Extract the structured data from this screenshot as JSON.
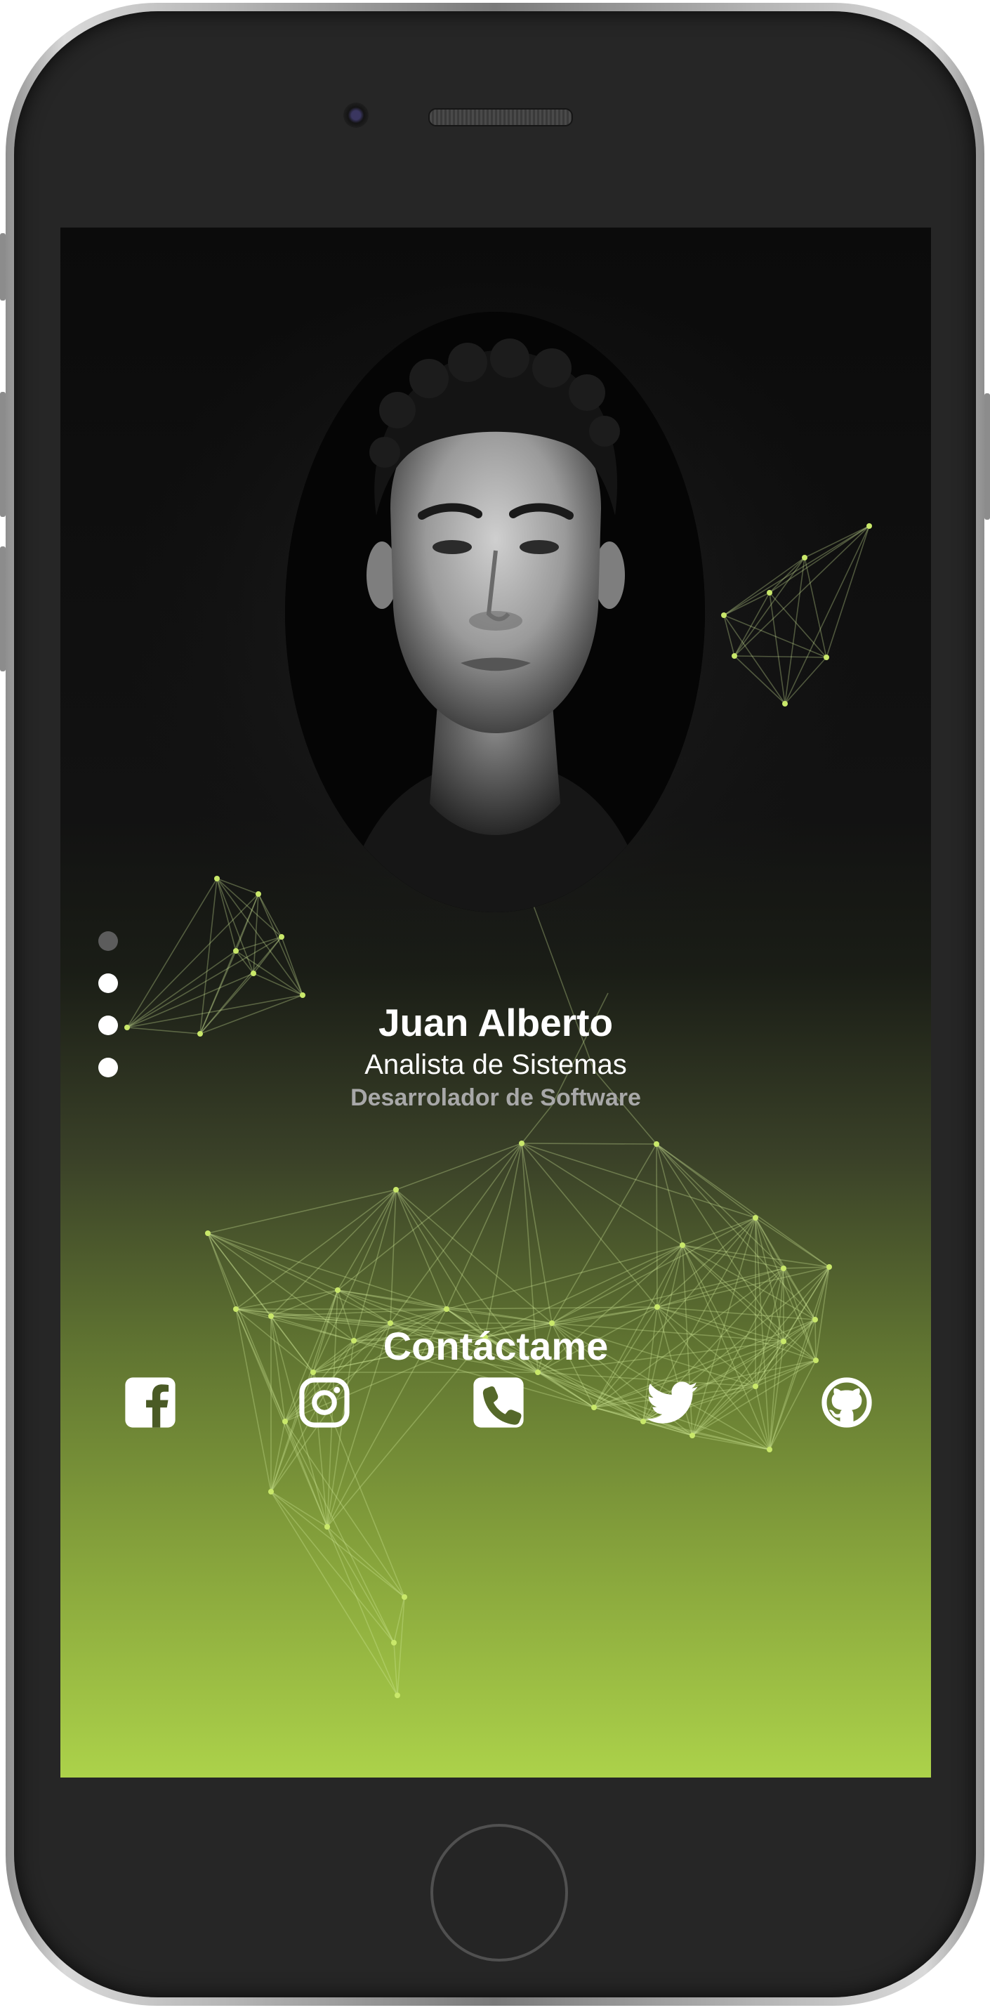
{
  "profile": {
    "name": "Juan Alberto",
    "role_primary": "Analista de Sistemas",
    "role_secondary": "Desarrolador de Software"
  },
  "contact": {
    "title": "Contáctame",
    "links": [
      {
        "icon": "facebook-icon"
      },
      {
        "icon": "instagram-icon"
      },
      {
        "icon": "phone-icon"
      },
      {
        "icon": "twitter-icon"
      },
      {
        "icon": "github-icon"
      }
    ]
  },
  "slider": {
    "count": 4,
    "active_index": 0
  },
  "colors": {
    "accent_green": "#acd24a",
    "background_dark": "#0b0b0b",
    "text_primary": "#ffffff",
    "text_secondary": "#a8a8a8"
  }
}
